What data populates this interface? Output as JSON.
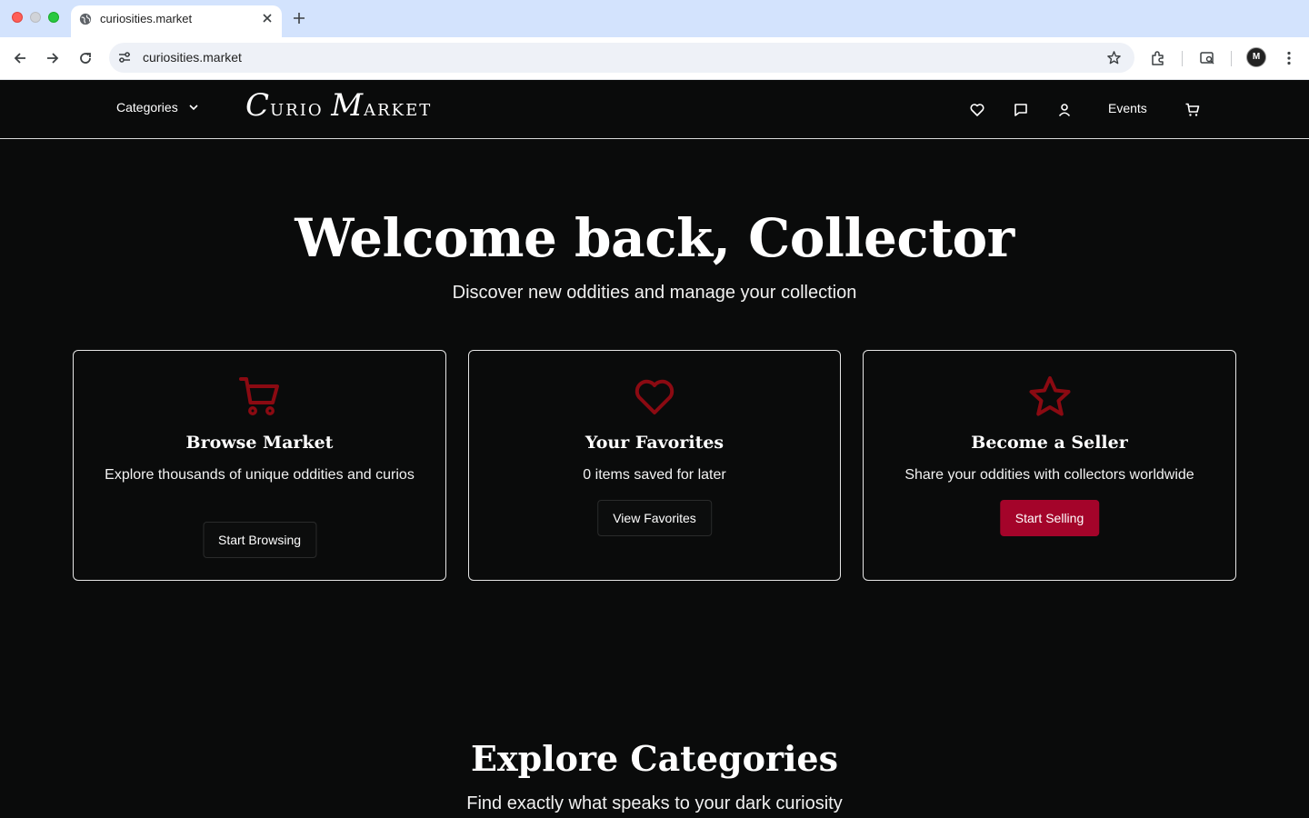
{
  "browser": {
    "tab_title": "curiosities.market",
    "url": "curiosities.market",
    "profile_initial": "M"
  },
  "header": {
    "categories_label": "Categories",
    "logo": {
      "c": "C",
      "urio": "urio",
      "m": "M",
      "arket": "arket"
    },
    "events_label": "Events"
  },
  "hero": {
    "title": "Welcome back, Collector",
    "subtitle": "Discover new oddities and manage your collection"
  },
  "cards": [
    {
      "icon": "cart-icon",
      "title": "Browse Market",
      "description": "Explore thousands of unique oddities and curios",
      "button": "Start Browsing"
    },
    {
      "icon": "heart-icon",
      "title": "Your Favorites",
      "description": "0 items saved for later",
      "button": "View Favorites"
    },
    {
      "icon": "star-icon",
      "title": "Become a Seller",
      "description": "Share your oddities with collectors worldwide",
      "button": "Start Selling"
    }
  ],
  "explore": {
    "title": "Explore Categories",
    "subtitle": "Find exactly what speaks to your dark curiosity"
  },
  "colors": {
    "accent": "#a4042a",
    "icon_red": "#8b0a12",
    "background": "#0a0b0b"
  }
}
